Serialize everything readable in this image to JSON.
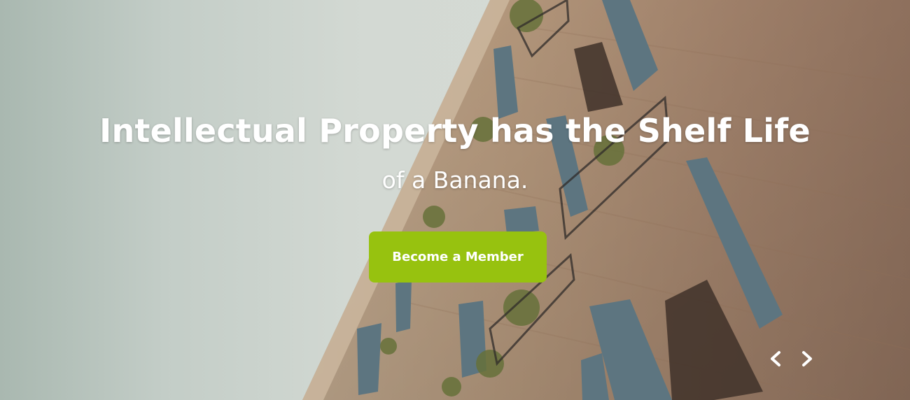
{
  "hero": {
    "headline": "Intellectual Property has the Shelf Life",
    "subline": "of a Banana.",
    "cta_label": "Become a Member",
    "accent_color": "#97c20f",
    "background_image": "building-facade-with-shuttered-windows-photo"
  },
  "carousel": {
    "prev_icon": "chevron-left-icon",
    "next_icon": "chevron-right-icon"
  }
}
